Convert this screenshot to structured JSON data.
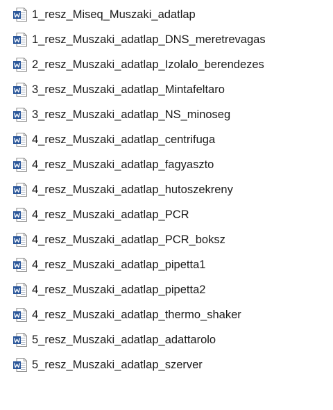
{
  "file_list": {
    "icon": "word-document-icon",
    "icon_colors": {
      "badge": "#2b579a",
      "page": "#ffffff",
      "page_border": "#8a8a8a",
      "lines": "#9aa6b8"
    },
    "items": [
      {
        "name": "1_resz_Miseq_Muszaki_adatlap"
      },
      {
        "name": "1_resz_Muszaki_adatlap_DNS_meretrevagas"
      },
      {
        "name": "2_resz_Muszaki_adatlap_Izolalo_berendezes"
      },
      {
        "name": "3_resz_Muszaki_adatlap_Mintafeltaro"
      },
      {
        "name": "3_resz_Muszaki_adatlap_NS_minoseg"
      },
      {
        "name": "4_resz_Muszaki_adatlap_centrifuga"
      },
      {
        "name": "4_resz_Muszaki_adatlap_fagyaszto"
      },
      {
        "name": "4_resz_Muszaki_adatlap_hutoszekreny"
      },
      {
        "name": "4_resz_Muszaki_adatlap_PCR"
      },
      {
        "name": "4_resz_Muszaki_adatlap_PCR_boksz"
      },
      {
        "name": "4_resz_Muszaki_adatlap_pipetta1"
      },
      {
        "name": "4_resz_Muszaki_adatlap_pipetta2"
      },
      {
        "name": "4_resz_Muszaki_adatlap_thermo_shaker"
      },
      {
        "name": "5_resz_Muszaki_adatlap_adattarolo"
      },
      {
        "name": "5_resz_Muszaki_adatlap_szerver"
      }
    ]
  }
}
